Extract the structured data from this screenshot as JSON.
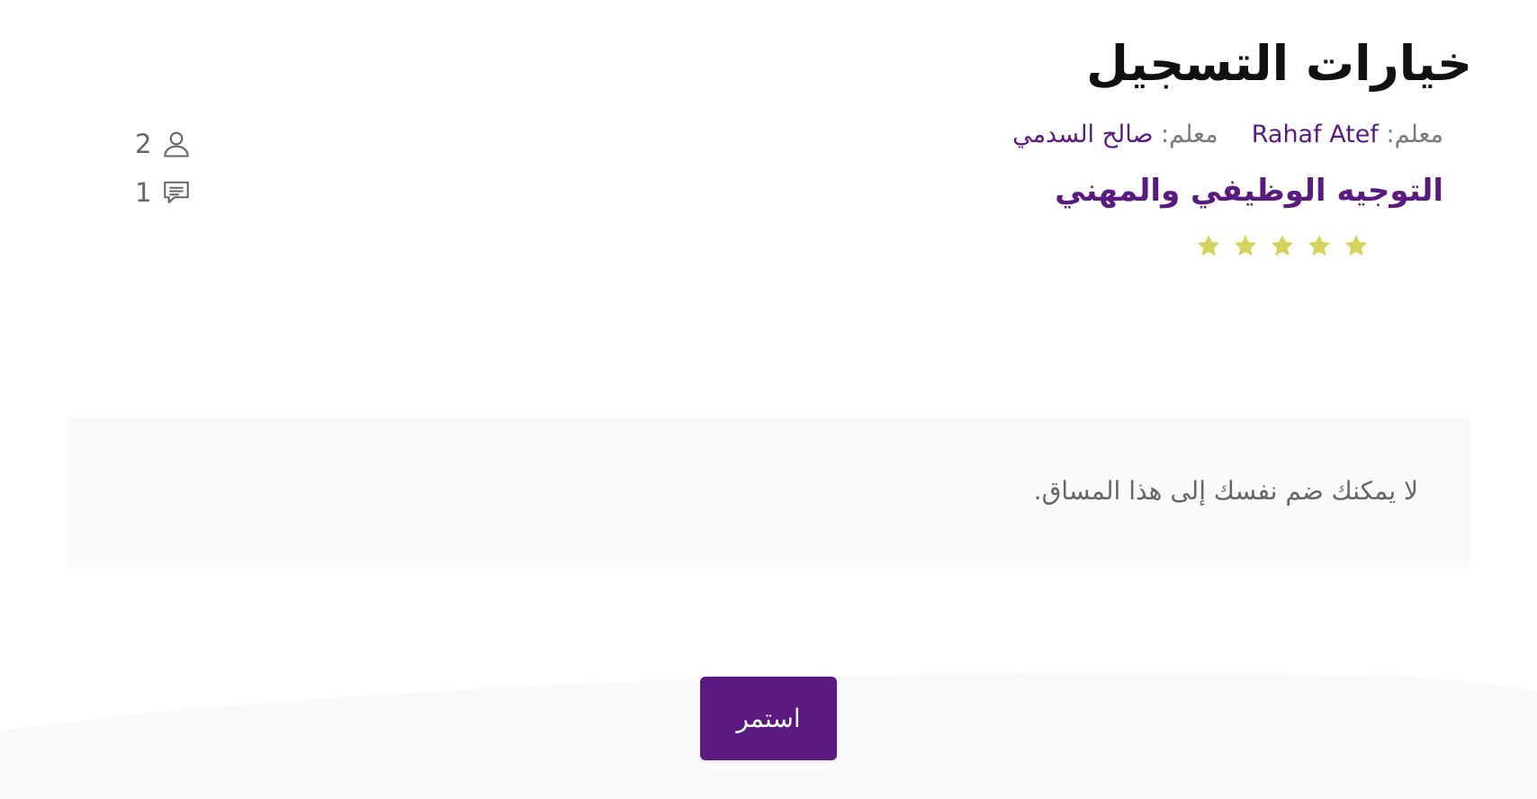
{
  "colors": {
    "accent": "#5a1a80",
    "star": "#d4d45a",
    "muted_text": "#7a7a7a",
    "panel_bg": "#f9fafb"
  },
  "header": {
    "title": "خيارات التسجيل"
  },
  "course": {
    "instructor_prefix_1": "معلم:",
    "instructor_name_1": "Rahaf Atef",
    "instructor_prefix_2": "معلم:",
    "instructor_name_2": "صالح السدمي",
    "name": "التوجيه الوظيفي والمهني",
    "rating": {
      "stars_filled": 5,
      "stars_total": 5
    }
  },
  "stats": {
    "participants_count": "2",
    "participants_icon": "user-icon",
    "comments_count": "1",
    "comments_icon": "comment-icon"
  },
  "notice": {
    "text": "لا يمكنك ضم نفسك إلى هذا المساق."
  },
  "actions": {
    "continue_label": "استمر"
  }
}
